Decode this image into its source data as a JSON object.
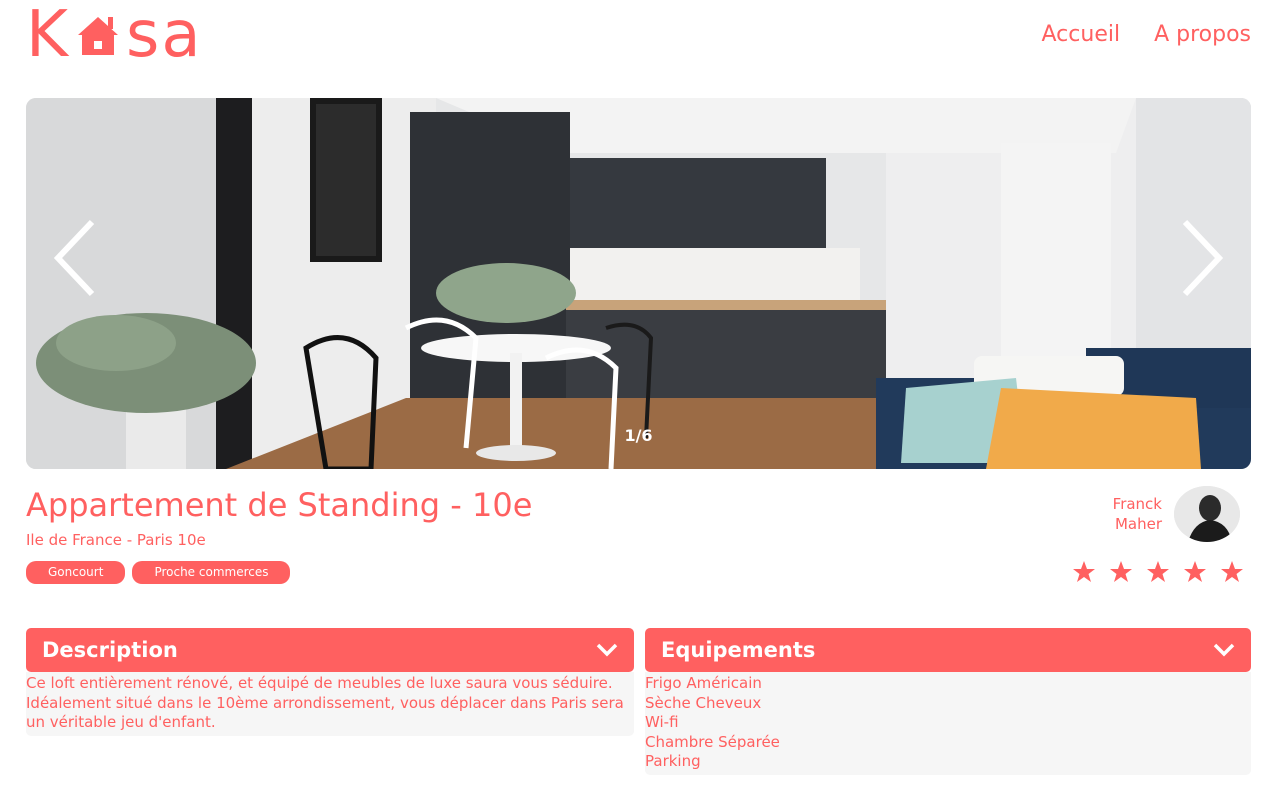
{
  "header": {
    "logo": {
      "left": "K",
      "right": "sa"
    },
    "nav": [
      {
        "label": "Accueil"
      },
      {
        "label": "A propos"
      }
    ]
  },
  "carousel": {
    "counter": "1/6"
  },
  "listing": {
    "title": "Appartement de Standing - 10e",
    "location": "Ile de France - Paris 10e",
    "tags": [
      "Goncourt",
      "Proche commerces"
    ],
    "host": {
      "first_name": "Franck",
      "last_name": "Maher"
    },
    "rating": 5
  },
  "description": {
    "title": "Description",
    "text": "Ce loft entièrement rénové, et équipé de meubles de luxe saura vous séduire. Idéalement situé dans le 10ème arrondissement, vous déplacer dans Paris sera un véritable jeu d'enfant."
  },
  "equipments": {
    "title": "Equipements",
    "items": [
      "Frigo Américain",
      "Sèche Cheveux",
      "Wi-fi",
      "Chambre Séparée",
      "Parking"
    ]
  },
  "colors": {
    "accent": "#FF6060",
    "panel": "#F6F6F6"
  },
  "icons": {
    "prev": "chevron-left-icon",
    "next": "chevron-right-icon",
    "collapse": "chevron-down-icon",
    "rating": "star-icon"
  }
}
